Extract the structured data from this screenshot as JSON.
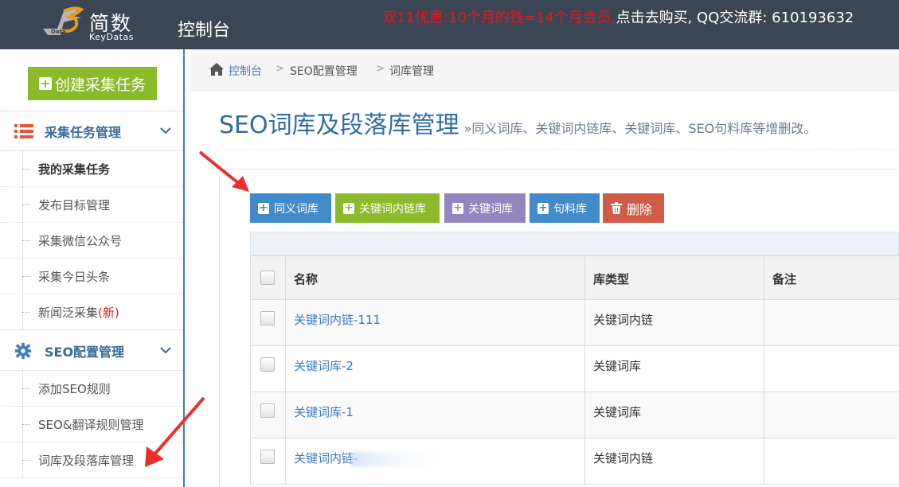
{
  "header": {
    "brand_cn": "简数",
    "brand_en": "KeyDatas",
    "logo_text": "Data",
    "console": "控制台",
    "promo_red": "双11优惠:10个月的钱=14个月会员,",
    "promo_white": "点击去购买, QQ交流群: 610193632"
  },
  "sidebar": {
    "create_button": "创建采集任务",
    "section1": {
      "label": "采集任务管理",
      "icon": "list-icon"
    },
    "section1_items": [
      {
        "label": "我的采集任务"
      },
      {
        "label": "发布目标管理"
      },
      {
        "label": "采集微信公众号"
      },
      {
        "label": "采集今日头条"
      },
      {
        "label": "新闻泛采集",
        "badge": "(新)"
      }
    ],
    "section2": {
      "label": "SEO配置管理",
      "icon": "gear-icon"
    },
    "section2_items": [
      {
        "label": "添加SEO规则"
      },
      {
        "label": "SEO&翻译规则管理"
      },
      {
        "label": "词库及段落库管理"
      }
    ]
  },
  "breadcrumb": {
    "home": "控制台",
    "level2": "SEO配置管理",
    "current": "词库管理",
    "separator": ">"
  },
  "page": {
    "title": "SEO词库及段落库管理",
    "subtitle": "»同义词库、关键词内链库、关键词库、SEO句料库等增删改。"
  },
  "toolbar": {
    "synonym": "同义词库",
    "keyword_link": "关键词内链库",
    "keyword": "关键词库",
    "sentence": "句料库",
    "delete": "删除"
  },
  "table": {
    "headers": {
      "name": "名称",
      "type": "库类型",
      "note": "备注"
    },
    "rows": [
      {
        "name": "关键词内链-111",
        "type": "关键词内链",
        "note": ""
      },
      {
        "name": "关键词库-2",
        "type": "关键词库",
        "note": ""
      },
      {
        "name": "关键词库-1",
        "type": "关键词库",
        "note": ""
      },
      {
        "name": "关键词内链-",
        "type": "关键词内链",
        "note": ""
      }
    ]
  },
  "colors": {
    "topbar": "#3a4654",
    "accent_blue": "#428bca",
    "accent_green": "#8bbb2b",
    "accent_purple": "#9686c0",
    "accent_red": "#d15b47",
    "annotation_red": "#e8312b"
  }
}
